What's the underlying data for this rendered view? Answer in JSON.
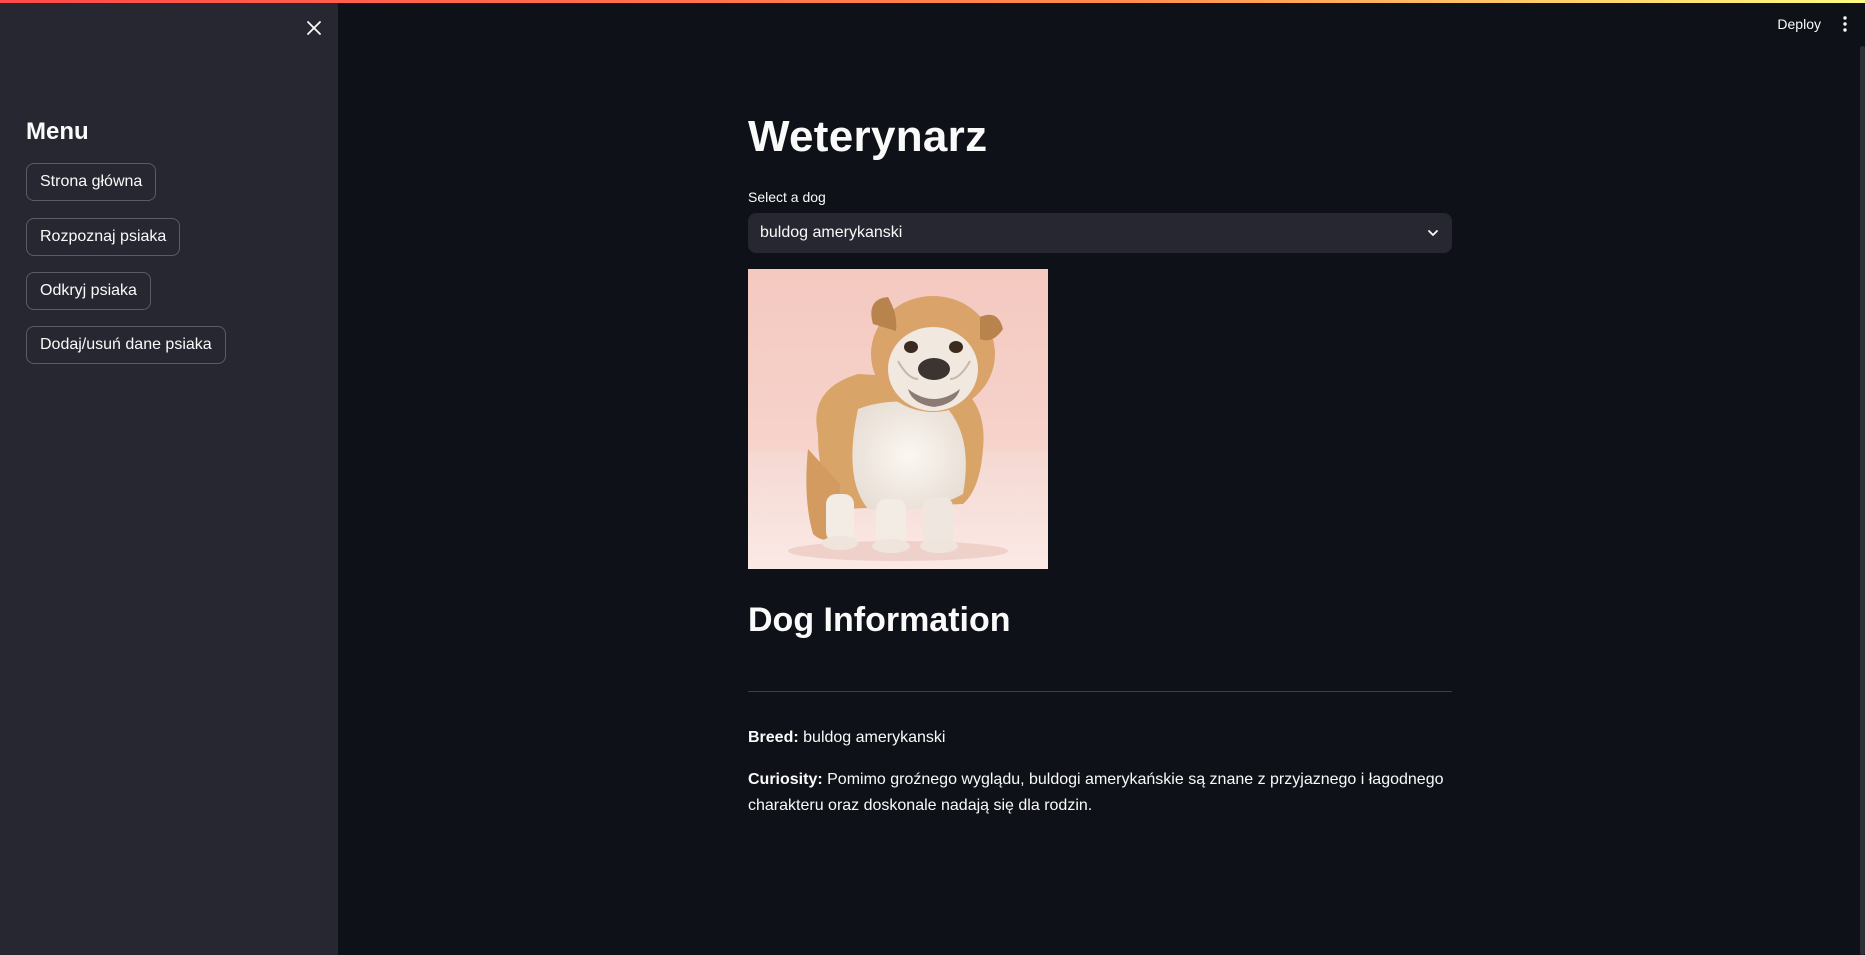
{
  "sidebar": {
    "title": "Menu",
    "items": [
      {
        "label": "Strona główna"
      },
      {
        "label": "Rozpoznaj psiaka"
      },
      {
        "label": "Odkryj psiaka"
      },
      {
        "label": "Dodaj/usuń dane psiaka"
      }
    ]
  },
  "header": {
    "deploy_label": "Deploy"
  },
  "main": {
    "title": "Weterynarz",
    "select": {
      "label": "Select a dog",
      "value": "buldog amerykanski"
    },
    "section_title": "Dog Information",
    "breed": {
      "label": "Breed:",
      "value": "buldog amerykanski"
    },
    "curiosity": {
      "label": "Curiosity:",
      "line1": "Pomimo groźnego wyglądu, buldogi amerykańskie są znane z przyjaznego i łagodnego",
      "line2": "charakteru oraz doskonale nadają się dla rodzin."
    }
  },
  "colors": {
    "background": "#0e1117",
    "sidebar": "#262730",
    "text": "#fafafa",
    "accent": "#ff4b4b"
  },
  "icons": {
    "close": "close-icon",
    "chevron": "chevron-down-icon",
    "menu": "kebab-menu-icon"
  }
}
